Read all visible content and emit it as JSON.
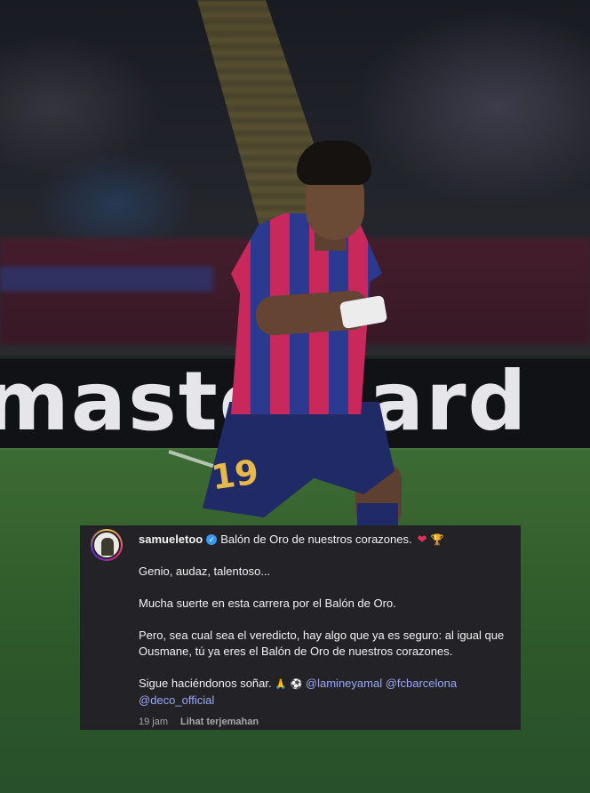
{
  "photo": {
    "board_text": "mastercard",
    "shirt_number": "19"
  },
  "comment": {
    "username": "samueletoo",
    "headline": "Balón de Oro de nuestros corazones.",
    "heart_icon": "❤",
    "trophy_icon": "🏆",
    "paragraph_1": "Genio, audaz, talentoso...",
    "paragraph_2": "Mucha suerte en esta carrera por el Balón de Oro.",
    "paragraph_3": "Pero, sea cual sea el veredicto, hay algo que ya es seguro: al igual que Ousmane, tú ya eres el Balón de Oro de nuestros corazones.",
    "paragraph_4_text": "Sigue haciéndonos soñar.",
    "pray_icon": "🙏",
    "ball_icon": "⚽",
    "mentions": [
      "@lamineyamal",
      "@fcbarcelona",
      "@deco_official"
    ],
    "time_ago": "19 jam",
    "translate_label": "Lihat terjemahan"
  },
  "colors": {
    "card_bg": "#232327",
    "mention": "#9aa8f5",
    "verified": "#3897f0"
  }
}
